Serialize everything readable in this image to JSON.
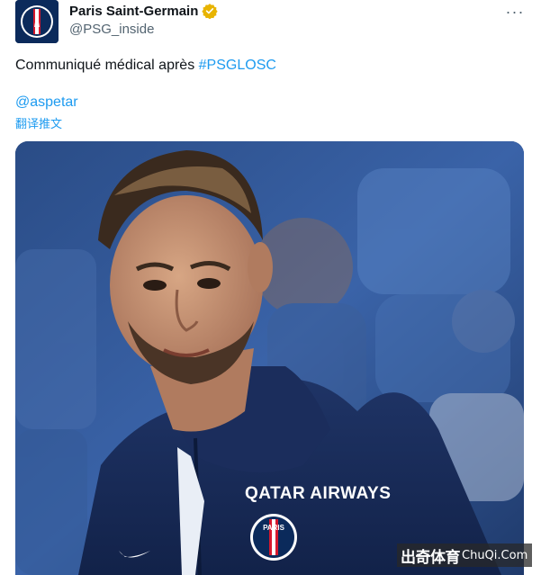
{
  "tweet": {
    "author_name": "Paris Saint-Germain",
    "author_handle": "@PSG_inside",
    "more_label": "···",
    "text_before": "Communiqué médical après ",
    "hashtag": "#PSGLOSC",
    "mention": "@aspetar",
    "translate_label": "翻译推文"
  },
  "media": {
    "jacket_brand": "QATAR AIRWAYS",
    "badge_text": "PARIS"
  },
  "watermark": {
    "cn": "出奇体育",
    "en": "ChuQi.Com"
  },
  "colors": {
    "link": "#1d9bf0",
    "verified": "#e8b400",
    "psg_navy": "#0b2a5b"
  }
}
